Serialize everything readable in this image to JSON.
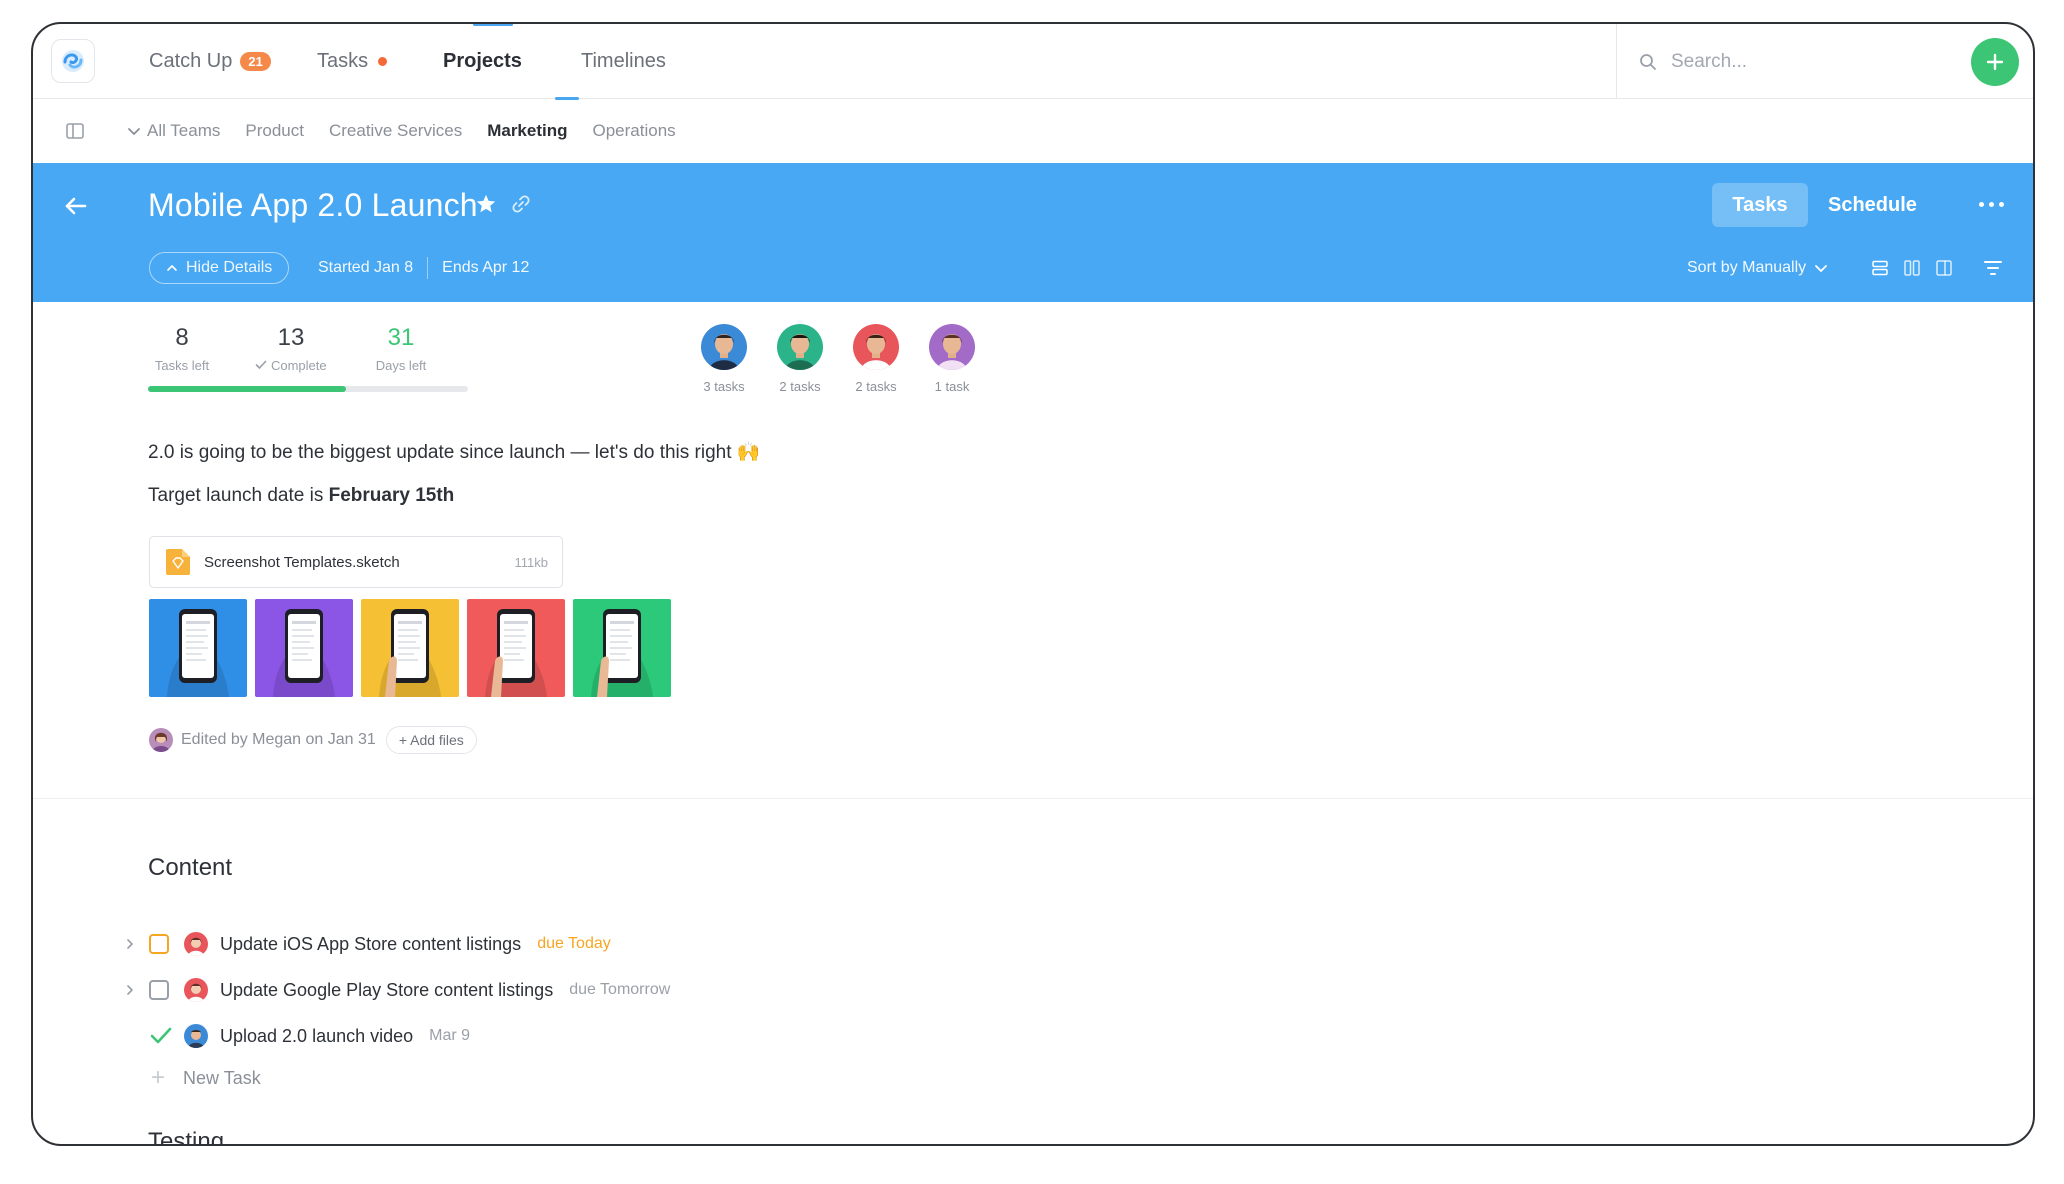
{
  "nav": {
    "tabs": [
      {
        "label": "Catch Up",
        "badge": "21"
      },
      {
        "label": "Tasks"
      },
      {
        "label": "Projects"
      },
      {
        "label": "Timelines"
      }
    ],
    "search_placeholder": "Search..."
  },
  "teams": [
    "All Teams",
    "Product",
    "Creative Services",
    "Marketing",
    "Operations"
  ],
  "project": {
    "title": "Mobile App 2.0 Launch",
    "hide_details": "Hide Details",
    "started": "Started Jan 8",
    "ends": "Ends Apr 12",
    "view_tasks": "Tasks",
    "view_schedule": "Schedule",
    "sort": "Sort by Manually"
  },
  "stats": {
    "tasks_left": {
      "value": "8",
      "label": "Tasks left"
    },
    "complete": {
      "value": "13",
      "label": "Complete"
    },
    "days_left": {
      "value": "31",
      "label": "Days left"
    },
    "progress": 0.62
  },
  "members": [
    {
      "count": "3 tasks",
      "color": "#3b8ad8"
    },
    {
      "count": "2 tasks",
      "color": "#2bb48a"
    },
    {
      "count": "2 tasks",
      "color": "#e8555a"
    },
    {
      "count": "1 task",
      "color": "#a16bc7"
    }
  ],
  "description": {
    "line1": "2.0 is going to be the biggest update since launch — let's do this right 🙌",
    "line2_prefix": "Target launch date is ",
    "line2_bold": "February 15th"
  },
  "attachment": {
    "name": "Screenshot Templates.sketch",
    "size": "111kb"
  },
  "thumbnail_colors": [
    "#2f8fe6",
    "#8b55e6",
    "#f5c033",
    "#f05a5a",
    "#2bc979"
  ],
  "edited": {
    "text": "Edited by Megan on Jan 31",
    "add_files": "+ Add files"
  },
  "sections": [
    {
      "title": "Content",
      "tasks": [
        {
          "label": "Update iOS App Store content listings",
          "due": "due Today",
          "state": "open-orange"
        },
        {
          "label": "Update Google Play Store content listings",
          "due": "due Tomorrow",
          "state": "open"
        },
        {
          "label": "Upload 2.0 launch video",
          "due": "Mar 9",
          "state": "done"
        }
      ],
      "new_task": "New Task"
    },
    {
      "title": "Testing"
    }
  ]
}
